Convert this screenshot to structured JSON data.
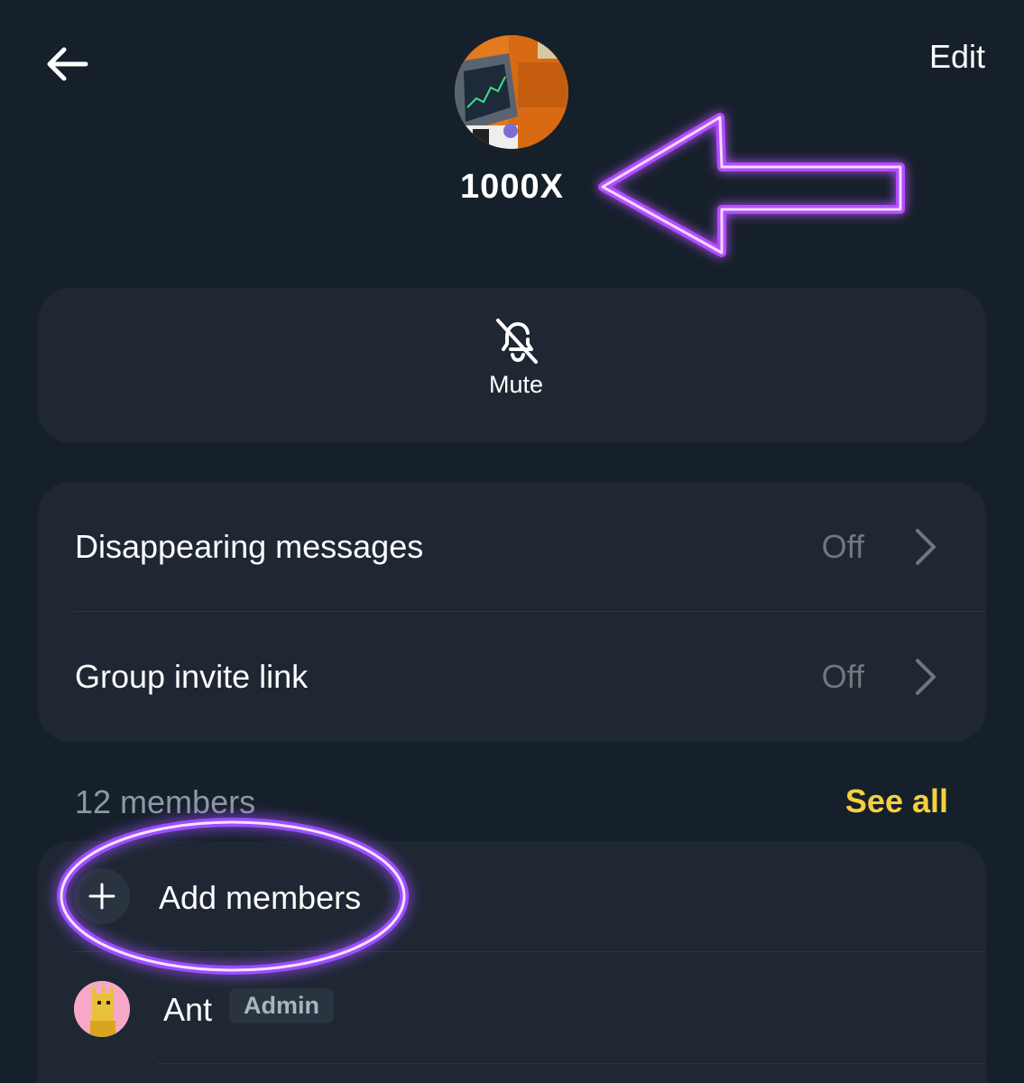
{
  "header": {
    "edit_label": "Edit"
  },
  "group": {
    "name": "1000X"
  },
  "actions": {
    "mute_label": "Mute"
  },
  "settings": [
    {
      "label": "Disappearing messages",
      "value": "Off"
    },
    {
      "label": "Group invite link",
      "value": "Off"
    }
  ],
  "members": {
    "count_label": "12 members",
    "see_all_label": "See all",
    "add_label": "Add members",
    "list": [
      {
        "name": "Ant",
        "badge": "Admin"
      }
    ]
  },
  "colors": {
    "background": "#16202a",
    "card": "#1e2732",
    "accent_yellow": "#f4d03f",
    "annotation_purple": "#b44dff"
  },
  "icons": [
    "back-arrow-icon",
    "bell-off-icon",
    "chevron-right-icon",
    "plus-icon"
  ]
}
